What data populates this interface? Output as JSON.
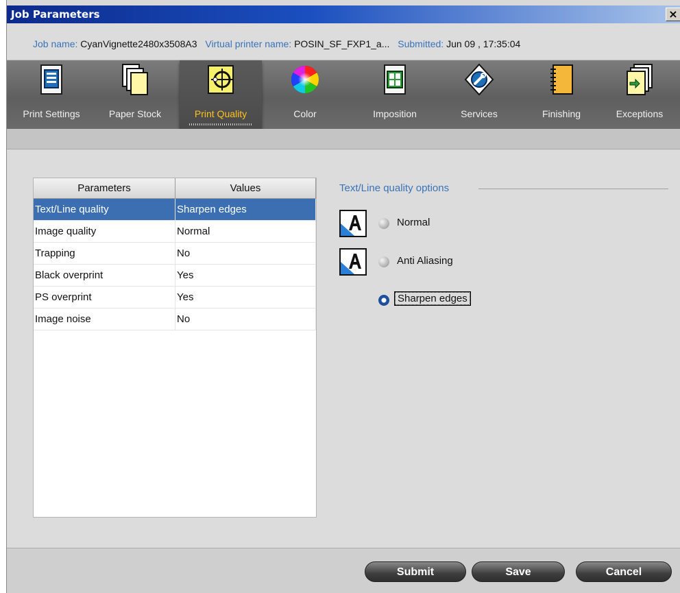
{
  "window": {
    "title": "Job Parameters",
    "close_label": "×"
  },
  "info": {
    "job_name_label": "Job name:",
    "job_name": "CyanVignette2480x3508A3",
    "printer_label": "Virtual printer name:",
    "printer_name": "POSIN_SF_FXP1_a...",
    "submitted_label": "Submitted:",
    "submitted": "Jun 09 , 17:35:04"
  },
  "toolbar": {
    "tabs": [
      {
        "label": "Print Settings",
        "icon": "print-settings-icon"
      },
      {
        "label": "Paper Stock",
        "icon": "paper-stock-icon"
      },
      {
        "label": "Print Quality",
        "icon": "print-quality-icon",
        "active": true
      },
      {
        "label": "Color",
        "icon": "color-wheel-icon"
      },
      {
        "label": "Imposition",
        "icon": "imposition-icon"
      },
      {
        "label": "Services",
        "icon": "services-icon"
      },
      {
        "label": "Finishing",
        "icon": "finishing-icon"
      },
      {
        "label": "Exceptions",
        "icon": "exceptions-icon"
      }
    ]
  },
  "params": {
    "header_param": "Parameters",
    "header_value": "Values",
    "rows": [
      {
        "name": "Text/Line quality",
        "value": "Sharpen edges",
        "selected": true
      },
      {
        "name": "Image quality",
        "value": "Normal"
      },
      {
        "name": "Trapping",
        "value": "No"
      },
      {
        "name": "Black overprint",
        "value": "Yes"
      },
      {
        "name": "PS overprint",
        "value": "Yes"
      },
      {
        "name": "Image noise",
        "value": "No"
      }
    ]
  },
  "options": {
    "title": "Text/Line quality options",
    "items": [
      {
        "label": "Normal",
        "checked": false,
        "icon": "text-quality-icon"
      },
      {
        "label": "Anti Aliasing",
        "checked": false,
        "icon": "text-quality-icon"
      },
      {
        "label": "Sharpen edges",
        "checked": true
      }
    ]
  },
  "buttons": {
    "submit": "Submit",
    "save": "Save",
    "cancel": "Cancel"
  }
}
